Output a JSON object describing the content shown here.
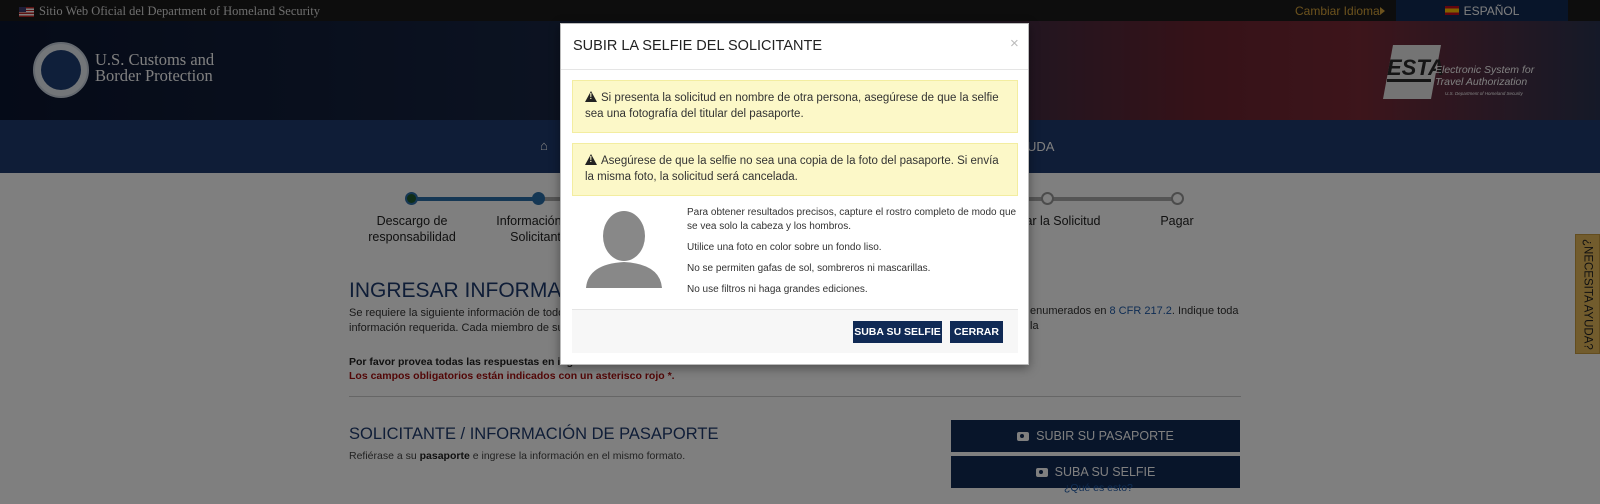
{
  "topbar": {
    "official": "Sitio Web Oficial del Department of Homeland Security",
    "change_language": "Cambiar Idioma",
    "language": "ESPAÑOL"
  },
  "header": {
    "agency_line1": "U.S. Customs and",
    "agency_line2": "Border Protection",
    "esta_logo": "ESTA",
    "esta_line1": "Electronic System for",
    "esta_line2": "Travel Authorization",
    "esta_sub": "U.S. Department of Homeland Security"
  },
  "nav": {
    "home_icon": "home-icon",
    "ayuda_partial": "UDA"
  },
  "steps": [
    {
      "label": "Descargo de responsabilidad",
      "state": "done"
    },
    {
      "label": "Información del Solicitante",
      "state": "current"
    },
    {
      "label": "",
      "state": "pending"
    },
    {
      "label": "",
      "state": "pending"
    },
    {
      "label": "ar la Solicitud",
      "state": "pending"
    },
    {
      "label": "Pagar",
      "state": "pending"
    }
  ],
  "main": {
    "heading": "INGRESAR INFORMACIÓN",
    "intro_left": "Se requiere la siguiente información de todos lo",
    "intro_left2": "información requerida. Cada miembro de su gru",
    "intro_right_pre": "enumerados en ",
    "intro_right_link": "8 CFR 217.2",
    "intro_right_post": ". Indique toda la",
    "english_note": "Por favor provea todas las respuestas en inglés.",
    "required_note": "Los campos obligatorios están indicados con un asterisco rojo *.",
    "section_heading": "SOLICITANTE / INFORMACIÓN DE PASAPORTE",
    "section_sub_pre": "Refiérase a su ",
    "section_sub_bold": "pasaporte",
    "section_sub_post": " e ingrese la información en el mismo formato.",
    "upload_passport": "SUBIR SU PASAPORTE",
    "upload_selfie": "SUBA SU SELFIE",
    "what_is": "¿Qué es esto?"
  },
  "help_tab": "¿NECESITA AYUDA?",
  "modal": {
    "title": "SUBIR LA SELFIE DEL SOLICITANTE",
    "close": "×",
    "warning1": "Si presenta la solicitud en nombre de otra persona, asegúrese de que la selfie sea una fotografía del titular del pasaporte.",
    "warning2": "Asegúrese de que la selfie no sea una copia de la foto del pasaporte. Si envía la misma foto, la solicitud será cancelada.",
    "instructions": [
      "Para obtener resultados precisos, capture el rostro completo de modo que se vea solo la cabeza y los hombros.",
      "Utilice una foto en color sobre un fondo liso.",
      "No se permiten gafas de sol, sombreros ni mascarillas.",
      "No use filtros ni haga grandes ediciones."
    ],
    "upload_button": "SUBA SU SELFIE",
    "close_button": "CERRAR"
  },
  "colors": {
    "navy": "#102a55",
    "nav_blue": "#1e3a6e",
    "warning_bg": "#fcf8c8",
    "help_tab": "#e4b85a"
  }
}
